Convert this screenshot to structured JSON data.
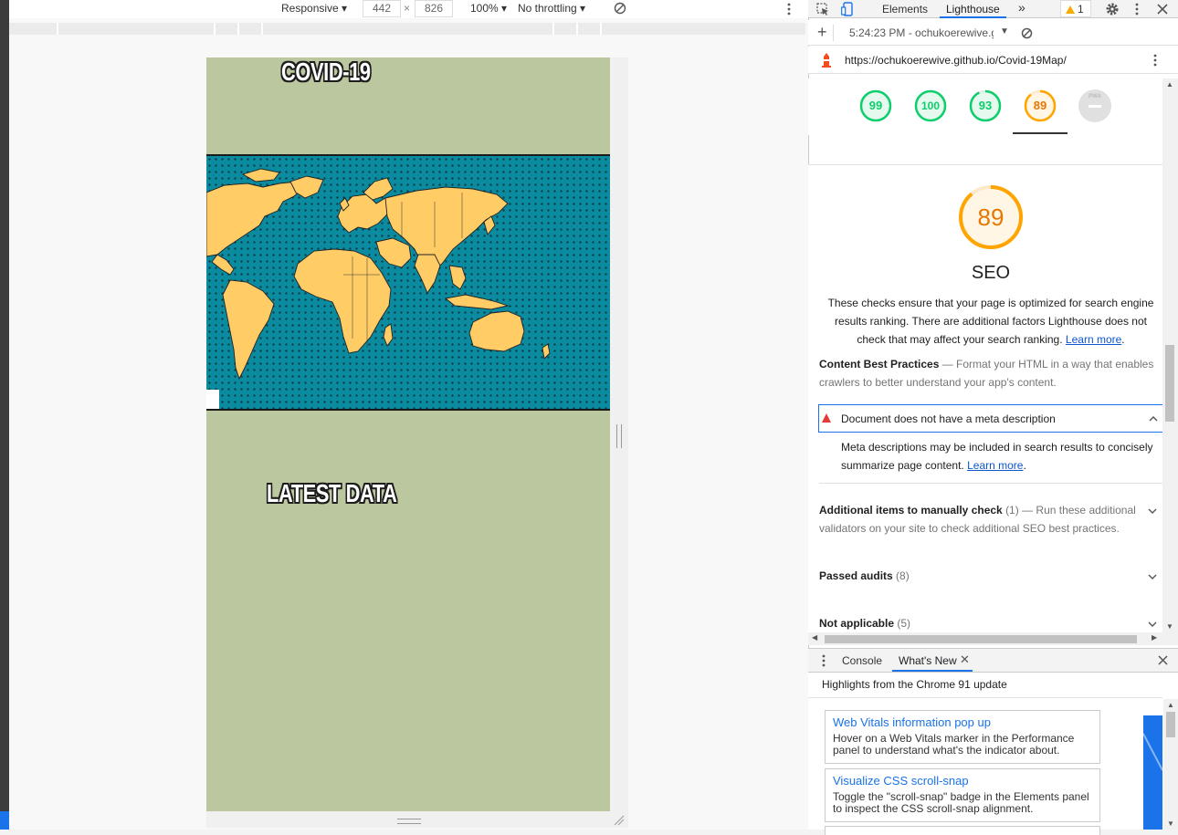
{
  "device_toolbar": {
    "device": "Responsive",
    "width": "442",
    "times": "×",
    "height": "826",
    "zoom": "100%",
    "throttle": "No throttling"
  },
  "page": {
    "title": "COVID-19",
    "section_title": "LATEST DATA"
  },
  "devtools": {
    "tabs": [
      "Elements",
      "Lighthouse"
    ],
    "more_tabs": "»",
    "warning_count": "1",
    "report_selector": "5:24:23 PM - ochukoerewive.g",
    "url": "https://ochukoerewive.github.io/Covid-19Map/",
    "scores": [
      {
        "value": "99",
        "color": "#0cce6b"
      },
      {
        "value": "100",
        "color": "#0cce6b"
      },
      {
        "value": "93",
        "color": "#0cce6b"
      },
      {
        "value": "89",
        "color": "#ffa400"
      }
    ],
    "pwa_label": "PWA",
    "seo": {
      "score": "89",
      "score_fraction": 0.89,
      "title": "SEO",
      "description": "These checks ensure that your page is optimized for search engine results ranking. There are additional factors Lighthouse does not check that may affect your search ranking.",
      "learn_more": "Learn more",
      "group_title": "Content Best Practices",
      "group_desc": "Format your HTML in a way that enables crawlers to better understand your app's content.",
      "failing_audit": "Document does not have a meta description",
      "failing_desc": "Meta descriptions may be included in search results to concisely summarize page content.",
      "failing_learn_more": "Learn more",
      "manual_title": "Additional items to manually check",
      "manual_count": "(1)",
      "manual_desc": "Run these additional validators on your site to check additional SEO best practices.",
      "passed_title": "Passed audits",
      "passed_count": "(8)",
      "na_title": "Not applicable",
      "na_count": "(5)"
    }
  },
  "drawer": {
    "tabs": [
      "Console",
      "What's New"
    ],
    "highlights": "Highlights from the Chrome 91 update",
    "cards": [
      {
        "title": "Web Vitals information pop up",
        "desc": "Hover on a Web Vitals marker in the Performance panel to understand what's the indicator about."
      },
      {
        "title": "Visualize CSS scroll-snap",
        "desc": "Toggle the \"scroll-snap\" badge in the Elements panel to inspect the CSS scroll-snap alignment."
      }
    ]
  }
}
